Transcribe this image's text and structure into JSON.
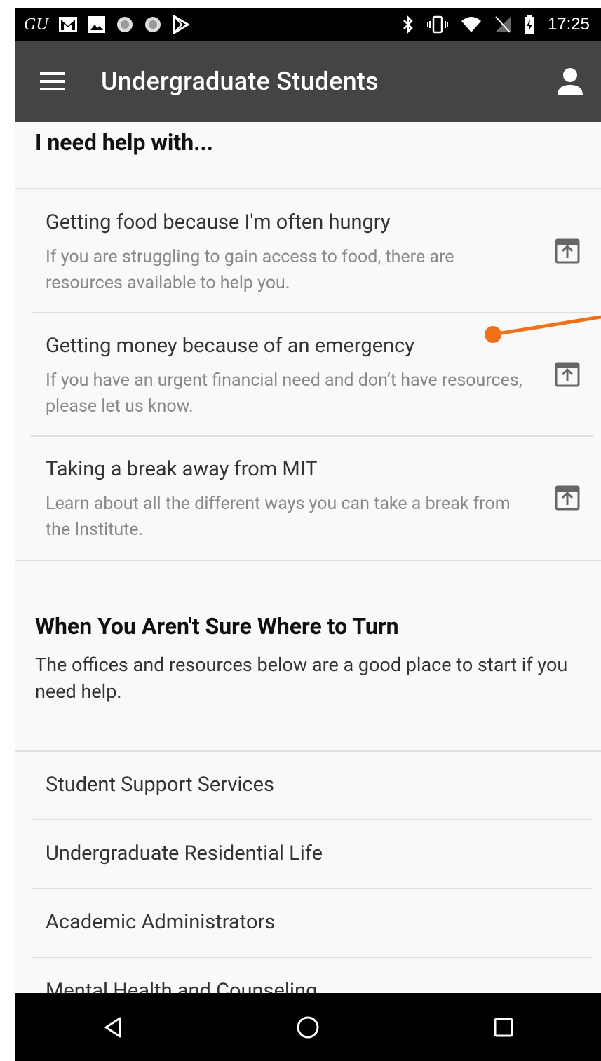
{
  "status_bar": {
    "left_icons": [
      "gu-brand-icon",
      "gmail-icon",
      "image-icon",
      "circle-icon",
      "circle-icon",
      "play-store-icon"
    ],
    "brand_text": "GU",
    "right_icons": [
      "bluetooth-icon",
      "vibrate-icon",
      "wifi-icon",
      "no-sim-icon",
      "battery-charging-icon"
    ],
    "time": "17:25"
  },
  "app_bar": {
    "title": "Undergraduate Students",
    "menu_icon": "hamburger-menu-icon",
    "account_icon": "account-icon"
  },
  "help_section": {
    "heading": "I need help with...",
    "items": [
      {
        "title": "Getting food because I'm often hungry",
        "description": "If you are struggling to gain access to food, there are resources available to help you.",
        "icon": "open-external-icon"
      },
      {
        "title": "Getting money because of an emergency",
        "description": "If you have an urgent financial need and don’t have resources, please let us know.",
        "icon": "open-external-icon"
      },
      {
        "title": "Taking a break away from MIT",
        "description": "Learn about all the different ways you can take a break from the Institute.",
        "icon": "open-external-icon"
      }
    ]
  },
  "turn_section": {
    "heading": "When You Aren't Sure Where to Turn",
    "subtitle": "The offices and resources below are a good place to start if you need help.",
    "items": [
      {
        "label": "Student Support Services"
      },
      {
        "label": "Undergraduate Residential Life"
      },
      {
        "label": "Academic Administrators"
      },
      {
        "label": "Mental Health and Counseling"
      }
    ]
  },
  "nav_bar": {
    "buttons": [
      "back-icon",
      "home-icon",
      "recents-icon"
    ]
  },
  "colors": {
    "app_bar": "#444444",
    "background": "#f9f9f9",
    "annotation": "#f07018"
  }
}
